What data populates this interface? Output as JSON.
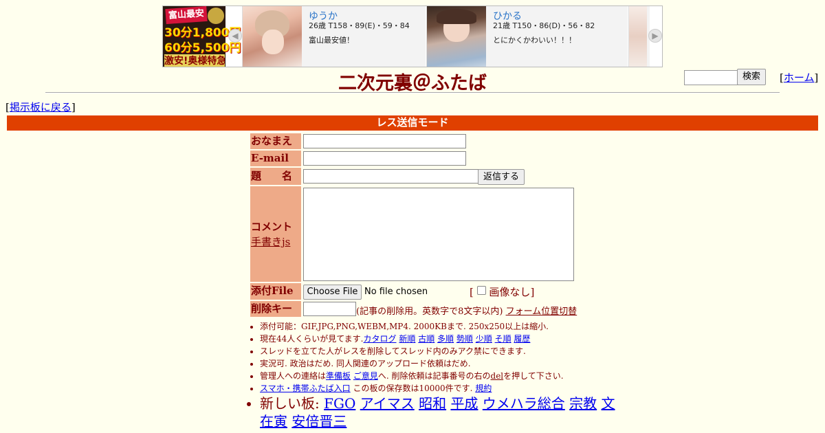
{
  "ad": {
    "brand_line1": "富山最安",
    "brand_line2": "30分1,800円",
    "brand_line3": "60分5,500円",
    "brand_line4": "激安!奥様特急",
    "cards": [
      {
        "name": "ゆうか",
        "stats": "26歳 T158・89(E)・59・84",
        "message": "富山最安値！"
      },
      {
        "name": "ひかる",
        "stats": "21歳 T150・86(D)・56・82",
        "message": "とにかくかわいい！！！"
      }
    ],
    "prev_arrow": "◀",
    "next_arrow": "▶"
  },
  "header": {
    "title": "二次元裏＠ふたば",
    "search_value": "",
    "search_button": "検索",
    "home_open": "[",
    "home_link": "ホーム",
    "home_close": "]"
  },
  "nav": {
    "back_open": "[",
    "back_link": "掲示板に戻る",
    "back_close": "]"
  },
  "mode_bar": "レス送信モード",
  "form": {
    "name_label": "おなまえ",
    "email_label": "E-mail",
    "subject_label": "題　　名",
    "submit_button": "返信する",
    "comment_label": "コメント",
    "tegaki_link": "手書きjs",
    "file_label": "添付File",
    "file_button": "Choose File",
    "file_status": "No file chosen",
    "no_image_open": "[",
    "no_image_label": "画像なし",
    "no_image_close": "]",
    "delkey_label": "削除キー",
    "delkey_note": "(記事の削除用。英数字で8文字以内)",
    "form_position_link": "フォーム位置切替"
  },
  "rules": {
    "r1": "添付可能：GIF,JPG,PNG,WEBM,MP4. 2000KBまで. 250x250以上は縮小.",
    "r2_prefix": "現在44人くらいが見てます.",
    "r2_links": [
      "カタログ",
      "新順",
      "古順",
      "多順",
      "勢順",
      "少順",
      "そ順",
      "履歴"
    ],
    "r3": "スレッドを立てた人がレスを削除してスレッド内のみアク禁にできます.",
    "r4": "実況可. 政治はだめ. 同人関連のアップロード依頼はだめ.",
    "r5_prefix": "管理人への連絡は",
    "r5_link1": "準備板",
    "r5_link2": "ご意見",
    "r5_mid": "へ. 削除依頼は記事番号の右の",
    "r5_link3": "del",
    "r5_suffix": "を押して下さい.",
    "r6_link": "スマホ・携帯ふたば入口",
    "r6_mid": "この板の保存数は10000件です.",
    "r6_link2": "規約",
    "r7_prefix": "新しい板:",
    "boards": [
      "FGO",
      "アイマス",
      "昭和",
      "平成",
      "ウメハラ総合",
      "宗教",
      "文在寅",
      "安倍晋三"
    ]
  },
  "colors": {
    "background": "#ffffee",
    "text": "#800000",
    "mode_bar": "#e04000",
    "label_bg": "#eeaa88",
    "link": "#0000ee"
  }
}
